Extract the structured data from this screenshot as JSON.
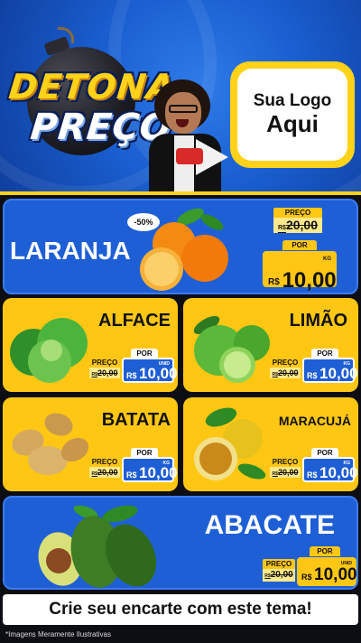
{
  "header": {
    "logo_line1": "DETONA",
    "logo_line2": "PREÇO",
    "placeholder_line1": "Sua Logo",
    "placeholder_line2": "Aqui"
  },
  "featured": {
    "name": "LARANJA",
    "discount_badge": "-50%",
    "old_label": "PREÇO",
    "old_currency": "R$",
    "old_price": "20,00",
    "new_label": "POR",
    "new_currency": "R$",
    "new_price": "10,00",
    "unit": "KG"
  },
  "items": [
    {
      "name": "ALFACE",
      "old_label": "PREÇO",
      "old_currency": "R$",
      "old_price": "20,00",
      "new_label": "POR",
      "new_currency": "R$",
      "new_price": "10,00",
      "unit": "UNID"
    },
    {
      "name": "LIMÃO",
      "old_label": "PREÇO",
      "old_currency": "R$",
      "old_price": "20,00",
      "new_label": "POR",
      "new_currency": "R$",
      "new_price": "10,00",
      "unit": "KG"
    },
    {
      "name": "BATATA",
      "old_label": "PREÇO",
      "old_currency": "R$",
      "old_price": "20,00",
      "new_label": "POR",
      "new_currency": "R$",
      "new_price": "10,00",
      "unit": "KG"
    },
    {
      "name": "MARACUJÁ",
      "old_label": "PREÇO",
      "old_currency": "R$",
      "old_price": "20,00",
      "new_label": "POR",
      "new_currency": "R$",
      "new_price": "10,00",
      "unit": "KG"
    }
  ],
  "bottom": {
    "name": "ABACATE",
    "old_label": "PREÇO",
    "old_currency": "R$",
    "old_price": "20,00",
    "new_label": "POR",
    "new_currency": "R$",
    "new_price": "10,00",
    "unit": "UNID"
  },
  "cta": "Crie seu encarte com este tema!",
  "disclaimer": "*Imagens Meramente Ilustrativas",
  "colors": {
    "brand_blue": "#1f5fd6",
    "brand_yellow": "#ffc714",
    "background": "#0d0d14"
  }
}
